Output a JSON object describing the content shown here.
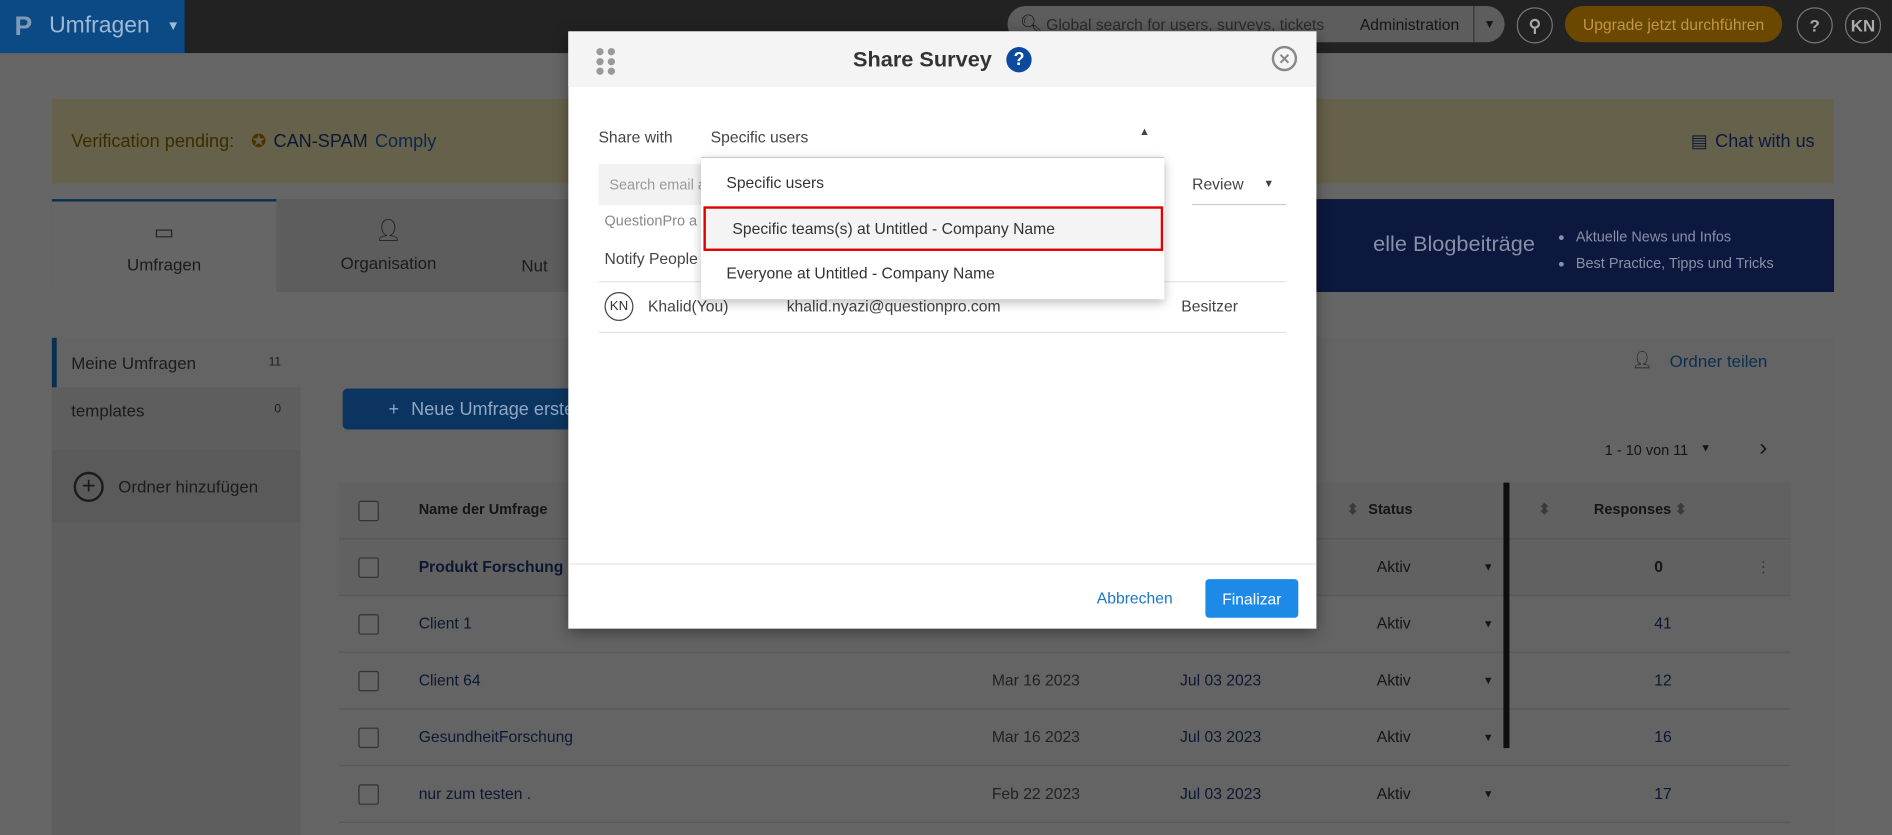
{
  "topbar": {
    "app_name": "Umfragen",
    "search_placeholder": "Global search for users, surveys, tickets",
    "scope": "Administration",
    "upgrade": "Upgrade jetzt durchführen",
    "help": "?",
    "avatar": "KN"
  },
  "banner": {
    "verification": "Verification pending:",
    "can_spam": "CAN-SPAM",
    "comply": "Comply",
    "chat": "Chat with us"
  },
  "tabs": [
    {
      "label": "Umfragen"
    },
    {
      "label": "Organisation"
    },
    {
      "label": "Nut"
    }
  ],
  "blog": {
    "title": "elle Blogbeiträge",
    "bullets": [
      "Aktuelle News und Infos",
      "Best Practice, Tipps und Tricks"
    ]
  },
  "sidebar": {
    "items": [
      {
        "label": "Meine Umfragen",
        "count": "11"
      },
      {
        "label": "templates",
        "count": "0"
      }
    ],
    "add_folder": "Ordner hinzufügen"
  },
  "main": {
    "new_survey": "Neue Umfrage erste",
    "share_folder": "Ordner teilen",
    "pager": "1 - 10 von 11"
  },
  "table": {
    "headers": {
      "name": "Name der Umfrage",
      "status": "Status",
      "responses": "Responses"
    },
    "rows": [
      {
        "name": "Produkt Forschung",
        "created": "",
        "modified": "",
        "status": "Aktiv",
        "responses": "0"
      },
      {
        "name": "Client 1",
        "created": "",
        "modified": "",
        "status": "Aktiv",
        "responses": "41"
      },
      {
        "name": "Client 64",
        "created": "Mar 16 2023",
        "modified": "Jul 03 2023",
        "status": "Aktiv",
        "responses": "12"
      },
      {
        "name": "GesundheitForschung",
        "created": "Mar 16 2023",
        "modified": "Jul 03 2023",
        "status": "Aktiv",
        "responses": "16"
      },
      {
        "name": "nur zum testen .",
        "created": "Feb 22 2023",
        "modified": "Jul 03 2023",
        "status": "Aktiv",
        "responses": "17"
      }
    ]
  },
  "modal": {
    "title": "Share Survey",
    "share_with_label": "Share with",
    "share_with_value": "Specific users",
    "search_placeholder": "Search email a",
    "role": "Review",
    "questionpro_note": "QuestionPro a",
    "notify": "Notify People",
    "options": [
      "Specific users",
      "Specific teams(s) at Untitled - Company Name",
      "Everyone at Untitled - Company Name"
    ],
    "user": {
      "initials": "KN",
      "name": "Khalid(You)",
      "email": "khalid.nyazi@questionpro.com",
      "role": "Besitzer"
    },
    "cancel": "Abbrechen",
    "finalize": "Finalizar"
  }
}
